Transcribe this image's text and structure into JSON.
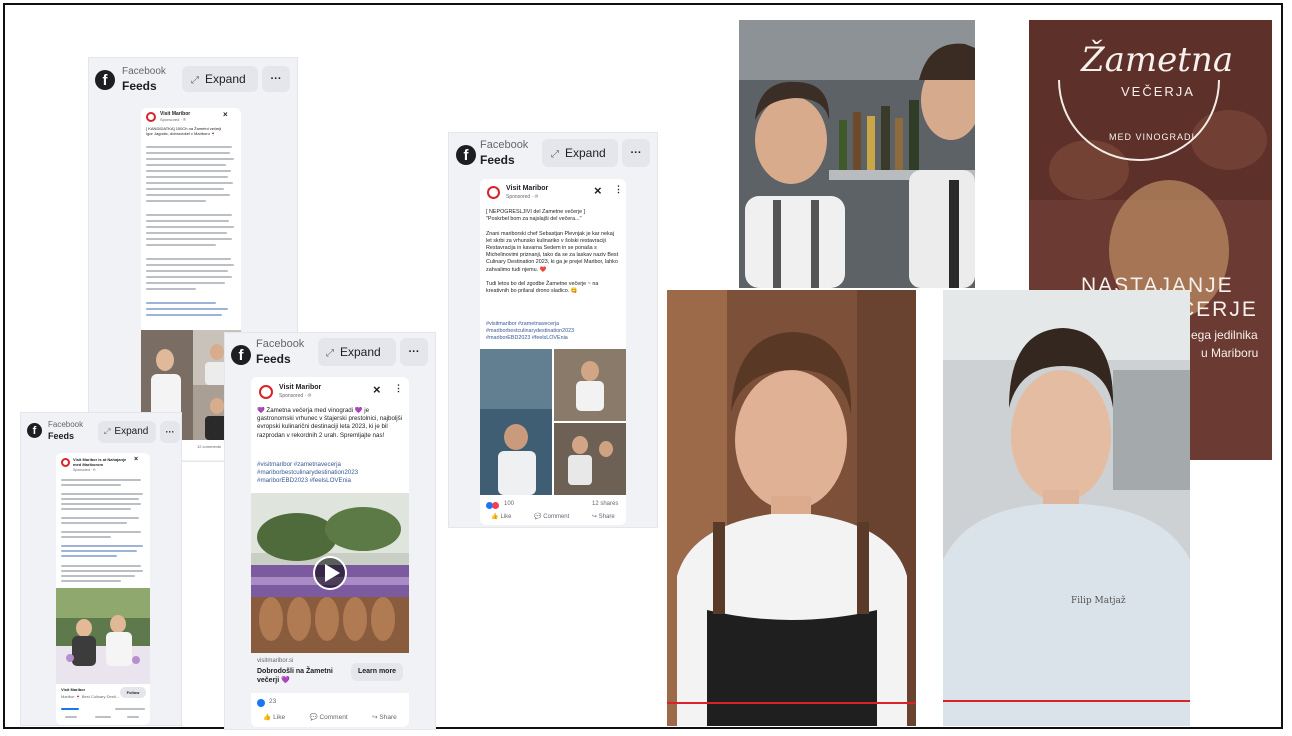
{
  "feed_header": {
    "platform": "Facebook",
    "feeds_label": "Feeds",
    "expand_label": "Expand",
    "more_label": "···"
  },
  "post_a": {
    "page_name": "Visit Maribor",
    "sponsored": "Sponsored · ℗",
    "intro": "[ KANDIDATKA] 100Ch na Žametni večerji\nIgor Jagodic, dobrodošel v Mariboru 🍷",
    "likes": "12 comments"
  },
  "post_b": {
    "page_name": "Visit Maribor",
    "sponsored": "Sponsored · ℗",
    "text": "💜 Žametna večerja med vinogradi 💜 je gastronomski vrhunec v štajerski prestolnici, najboljši evropski kulinarični destinaciji leta 2023, ki je bil razprodan v rekordnih 2 urah. Spremljajte nas!",
    "hashtags": "#visitmaribor #zametnavecerja\n#mariborbestculinarydestination2023\n#mariborEBD2023 #feelsLOVEnia",
    "link_domain": "visitmaribor.si",
    "link_title": "Dobrodošli na Žametni večerji 💜",
    "cta": "Learn more",
    "reactions": "23",
    "like": "Like",
    "comment": "Comment",
    "share": "Share"
  },
  "post_c": {
    "page_name": "Visit Maribor",
    "sponsored": "Sponsored · ℗",
    "text": "[ NEPOGREŠLJIVI del Žametne večerje ]\n\"Poskrbel bom za najslajši del večera...\"\n\nZnani mariborski chef Sebastjan Plevnjak je kar nekaj let skrbi za vrhunsko kulinariko v šolski restavraciji Restavracija in kavarna Sedem in se ponaša s Michelinovimi priznanji, tako da se za laskav naziv Best Culinary Destination 2023, ki ga je prejel Maribor, lahko zahvalimo tudi njemu. ❤️\n\nTudi letos bo del zgodbe Žametne večerje ~ na kreativnih bo prilaral drono sladico. 😋",
    "hashtags": "#visitmaribor #zametnavecerja\n#mariborbestculinarydestination2023\n#mariborEBD2023 #feelsLOVEnia",
    "reactions": "100",
    "shares": "12 shares",
    "like": "Like",
    "comment": "Comment",
    "share": "Share"
  },
  "post_d": {
    "page_name": "Visit Maribor is at Nahajanje med Mariborom",
    "sponsored": "Sponsored · ℗",
    "footer_name": "Visit Maribor",
    "footer_sub": "Maribor 🍷 Best Culinary Desti...",
    "follow": "Follow"
  },
  "brand": {
    "logo_script": "Žametna",
    "logo_sub": "VEČERJA",
    "logo_arc": "MED VINOGRADI",
    "overlay_line1": "NASTAJANJE",
    "overlay_line2": "ČERJE",
    "overlay_line3": "ega jedilnika",
    "overlay_line4": "u Mariboru"
  },
  "chef_name": "Filip Matjaž",
  "colors": {
    "fb_blue": "#1877f2",
    "link_blue": "#385898",
    "brand_red": "#d8232a",
    "purple": "#7b3fa0"
  }
}
